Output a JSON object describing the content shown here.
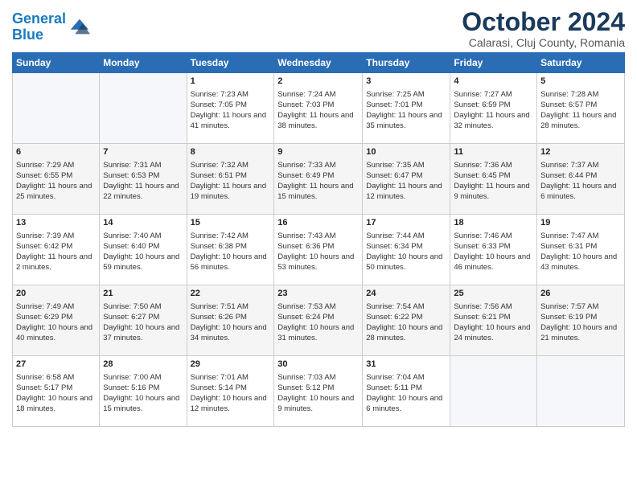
{
  "logo": {
    "line1": "General",
    "line2": "Blue"
  },
  "title": "October 2024",
  "subtitle": "Calarasi, Cluj County, Romania",
  "days_header": [
    "Sunday",
    "Monday",
    "Tuesday",
    "Wednesday",
    "Thursday",
    "Friday",
    "Saturday"
  ],
  "weeks": [
    [
      {
        "num": "",
        "detail": ""
      },
      {
        "num": "",
        "detail": ""
      },
      {
        "num": "1",
        "detail": "Sunrise: 7:23 AM\nSunset: 7:05 PM\nDaylight: 11 hours and 41 minutes."
      },
      {
        "num": "2",
        "detail": "Sunrise: 7:24 AM\nSunset: 7:03 PM\nDaylight: 11 hours and 38 minutes."
      },
      {
        "num": "3",
        "detail": "Sunrise: 7:25 AM\nSunset: 7:01 PM\nDaylight: 11 hours and 35 minutes."
      },
      {
        "num": "4",
        "detail": "Sunrise: 7:27 AM\nSunset: 6:59 PM\nDaylight: 11 hours and 32 minutes."
      },
      {
        "num": "5",
        "detail": "Sunrise: 7:28 AM\nSunset: 6:57 PM\nDaylight: 11 hours and 28 minutes."
      }
    ],
    [
      {
        "num": "6",
        "detail": "Sunrise: 7:29 AM\nSunset: 6:55 PM\nDaylight: 11 hours and 25 minutes."
      },
      {
        "num": "7",
        "detail": "Sunrise: 7:31 AM\nSunset: 6:53 PM\nDaylight: 11 hours and 22 minutes."
      },
      {
        "num": "8",
        "detail": "Sunrise: 7:32 AM\nSunset: 6:51 PM\nDaylight: 11 hours and 19 minutes."
      },
      {
        "num": "9",
        "detail": "Sunrise: 7:33 AM\nSunset: 6:49 PM\nDaylight: 11 hours and 15 minutes."
      },
      {
        "num": "10",
        "detail": "Sunrise: 7:35 AM\nSunset: 6:47 PM\nDaylight: 11 hours and 12 minutes."
      },
      {
        "num": "11",
        "detail": "Sunrise: 7:36 AM\nSunset: 6:45 PM\nDaylight: 11 hours and 9 minutes."
      },
      {
        "num": "12",
        "detail": "Sunrise: 7:37 AM\nSunset: 6:44 PM\nDaylight: 11 hours and 6 minutes."
      }
    ],
    [
      {
        "num": "13",
        "detail": "Sunrise: 7:39 AM\nSunset: 6:42 PM\nDaylight: 11 hours and 2 minutes."
      },
      {
        "num": "14",
        "detail": "Sunrise: 7:40 AM\nSunset: 6:40 PM\nDaylight: 10 hours and 59 minutes."
      },
      {
        "num": "15",
        "detail": "Sunrise: 7:42 AM\nSunset: 6:38 PM\nDaylight: 10 hours and 56 minutes."
      },
      {
        "num": "16",
        "detail": "Sunrise: 7:43 AM\nSunset: 6:36 PM\nDaylight: 10 hours and 53 minutes."
      },
      {
        "num": "17",
        "detail": "Sunrise: 7:44 AM\nSunset: 6:34 PM\nDaylight: 10 hours and 50 minutes."
      },
      {
        "num": "18",
        "detail": "Sunrise: 7:46 AM\nSunset: 6:33 PM\nDaylight: 10 hours and 46 minutes."
      },
      {
        "num": "19",
        "detail": "Sunrise: 7:47 AM\nSunset: 6:31 PM\nDaylight: 10 hours and 43 minutes."
      }
    ],
    [
      {
        "num": "20",
        "detail": "Sunrise: 7:49 AM\nSunset: 6:29 PM\nDaylight: 10 hours and 40 minutes."
      },
      {
        "num": "21",
        "detail": "Sunrise: 7:50 AM\nSunset: 6:27 PM\nDaylight: 10 hours and 37 minutes."
      },
      {
        "num": "22",
        "detail": "Sunrise: 7:51 AM\nSunset: 6:26 PM\nDaylight: 10 hours and 34 minutes."
      },
      {
        "num": "23",
        "detail": "Sunrise: 7:53 AM\nSunset: 6:24 PM\nDaylight: 10 hours and 31 minutes."
      },
      {
        "num": "24",
        "detail": "Sunrise: 7:54 AM\nSunset: 6:22 PM\nDaylight: 10 hours and 28 minutes."
      },
      {
        "num": "25",
        "detail": "Sunrise: 7:56 AM\nSunset: 6:21 PM\nDaylight: 10 hours and 24 minutes."
      },
      {
        "num": "26",
        "detail": "Sunrise: 7:57 AM\nSunset: 6:19 PM\nDaylight: 10 hours and 21 minutes."
      }
    ],
    [
      {
        "num": "27",
        "detail": "Sunrise: 6:58 AM\nSunset: 5:17 PM\nDaylight: 10 hours and 18 minutes."
      },
      {
        "num": "28",
        "detail": "Sunrise: 7:00 AM\nSunset: 5:16 PM\nDaylight: 10 hours and 15 minutes."
      },
      {
        "num": "29",
        "detail": "Sunrise: 7:01 AM\nSunset: 5:14 PM\nDaylight: 10 hours and 12 minutes."
      },
      {
        "num": "30",
        "detail": "Sunrise: 7:03 AM\nSunset: 5:12 PM\nDaylight: 10 hours and 9 minutes."
      },
      {
        "num": "31",
        "detail": "Sunrise: 7:04 AM\nSunset: 5:11 PM\nDaylight: 10 hours and 6 minutes."
      },
      {
        "num": "",
        "detail": ""
      },
      {
        "num": "",
        "detail": ""
      }
    ]
  ]
}
